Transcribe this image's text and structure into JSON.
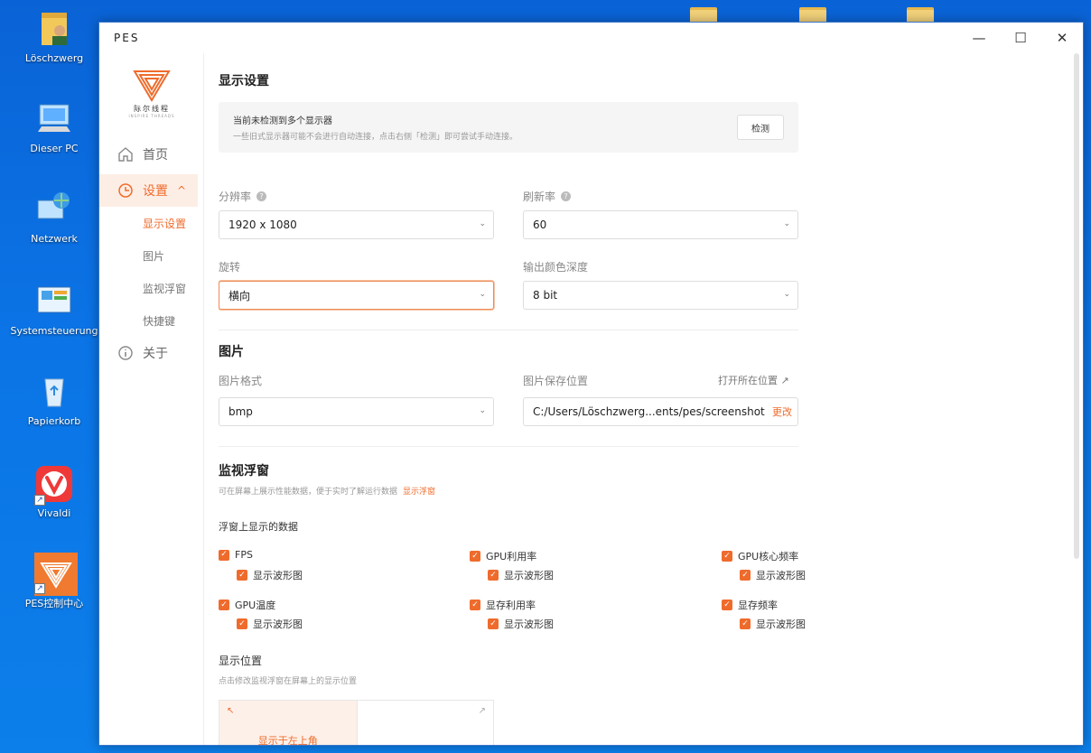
{
  "desktop": {
    "icons": [
      {
        "label": "Löschzwerg"
      },
      {
        "label": "Dieser PC"
      },
      {
        "label": "Netzwerk"
      },
      {
        "label": "Systemsteuerung"
      },
      {
        "label": "Papierkorb"
      },
      {
        "label": "Vivaldi"
      },
      {
        "label": "PES控制中心"
      }
    ]
  },
  "window": {
    "title": "PES",
    "controls": {
      "minimize": "—",
      "maximize": "☐",
      "close": "✕"
    }
  },
  "sidebar": {
    "brand": "际尔线程",
    "brand_sub": "INSPIRE THREADS",
    "nav": [
      {
        "label": "首页"
      },
      {
        "label": "设置",
        "expander": "^"
      },
      {
        "label": "关于"
      }
    ],
    "sub_items": [
      {
        "label": "显示设置"
      },
      {
        "label": "图片"
      },
      {
        "label": "监视浮窗"
      },
      {
        "label": "快捷键"
      }
    ]
  },
  "display": {
    "title": "显示设置",
    "notice_title": "当前未检测到多个显示器",
    "notice_text": "一些旧式显示器可能不会进行自动连接，点击右侧「检测」即可尝试手动连接。",
    "detect_button": "检测",
    "resolution_label": "分辨率",
    "resolution_value": "1920 x 1080",
    "refresh_label": "刷新率",
    "refresh_value": "60",
    "rotation_label": "旋转",
    "rotation_value": "横向",
    "depth_label": "输出颜色深度",
    "depth_value": "8 bit"
  },
  "image": {
    "title": "图片",
    "format_label": "图片格式",
    "format_value": "bmp",
    "save_label": "图片保存位置",
    "open_location": "打开所在位置",
    "path_value": "C:/Users/Löschzwerg...ents/pes/screenshot",
    "change_label": "更改"
  },
  "monitor": {
    "title": "监视浮窗",
    "description": "可在屏幕上展示性能数据，便于实时了解运行数据",
    "show_link": "显示浮窗",
    "data_title": "浮窗上显示的数据",
    "waveform_label": "显示波形图",
    "items": [
      {
        "label": "FPS"
      },
      {
        "label": "GPU利用率"
      },
      {
        "label": "GPU核心频率"
      },
      {
        "label": "GPU温度"
      },
      {
        "label": "显存利用率"
      },
      {
        "label": "显存频率"
      }
    ],
    "position_title": "显示位置",
    "position_desc": "点击修改监视浮窗在屏幕上的显示位置",
    "position_active": "显示于左上角"
  },
  "colors": {
    "accent": "#ef6b2c",
    "desktop": "#0b74e6"
  }
}
